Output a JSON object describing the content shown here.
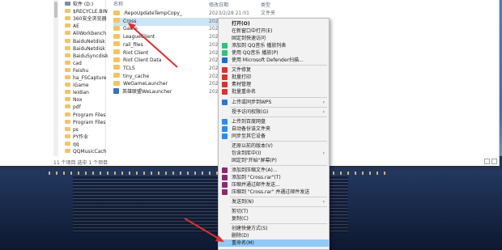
{
  "explorer": {
    "nav_items": [
      {
        "label": "软件 (D:)",
        "kind": "drive"
      },
      {
        "label": "$RECYCLE.BIN",
        "kind": "folder"
      },
      {
        "label": "360安全浏览器",
        "kind": "folder"
      },
      {
        "label": "AE",
        "kind": "folder"
      },
      {
        "label": "AliWorkbench",
        "kind": "folder"
      },
      {
        "label": "BaiduNetdisk",
        "kind": "folder"
      },
      {
        "label": "BaiduNetdisk",
        "kind": "folder"
      },
      {
        "label": "BaiduSyncdisk",
        "kind": "folder"
      },
      {
        "label": "cad",
        "kind": "folder"
      },
      {
        "label": "Feishu",
        "kind": "folder"
      },
      {
        "label": "ha_FSCapture",
        "kind": "folder"
      },
      {
        "label": "iGame",
        "kind": "folder"
      },
      {
        "label": "leidian",
        "kind": "folder"
      },
      {
        "label": "Nox",
        "kind": "folder"
      },
      {
        "label": "pdf",
        "kind": "folder"
      },
      {
        "label": "Program Files",
        "kind": "folder"
      },
      {
        "label": "Program Files",
        "kind": "folder"
      },
      {
        "label": "ps",
        "kind": "folder"
      },
      {
        "label": "PY作业",
        "kind": "folder"
      },
      {
        "label": "qq",
        "kind": "folder"
      },
      {
        "label": "QQMusicCach",
        "kind": "folder"
      }
    ],
    "header_name": "名称",
    "header_date": "修改日期",
    "header_type": "类型",
    "files": [
      {
        "name": ".RepoUpdateTempCopy_",
        "icon": "folder",
        "date": "2023/2/28 21:01",
        "type": "文件夹"
      },
      {
        "name": "Cross",
        "icon": "folder",
        "date": "2023/",
        "type": "",
        "selected": true
      },
      {
        "name": "Game",
        "icon": "folder",
        "date": "2023/",
        "type": ""
      },
      {
        "name": "LeagueClient",
        "icon": "folder",
        "date": "2023/",
        "type": ""
      },
      {
        "name": "rail_files",
        "icon": "folder",
        "date": "2023/",
        "type": ""
      },
      {
        "name": "Riot Client",
        "icon": "folder",
        "date": "2023/",
        "type": ""
      },
      {
        "name": "Riot Client Data",
        "icon": "folder",
        "date": "2023/",
        "type": ""
      },
      {
        "name": "TCLS",
        "icon": "folder",
        "date": "2023/",
        "type": ""
      },
      {
        "name": "tiny_cache",
        "icon": "folder",
        "date": "2023/",
        "type": ""
      },
      {
        "name": "WeGameLauncher",
        "icon": "folder",
        "date": "2023/",
        "type": ""
      },
      {
        "name": "英雄联盟WeLauncher",
        "icon": "app",
        "date": "2023/",
        "type": ""
      }
    ],
    "status": "11 个项目    选中 1 个项目"
  },
  "context_menu": {
    "items": [
      {
        "label": "打开(O)",
        "icon": "none",
        "bold": true
      },
      {
        "label": "在新窗口中打开(E)",
        "icon": "none"
      },
      {
        "label": "固定到快速访问",
        "icon": "none"
      },
      {
        "label": "添加到 QQ音乐 播放列表",
        "icon": "qqmusic-icon",
        "color": "#31c27c"
      },
      {
        "label": "使用 QQ音乐 播放(P)",
        "icon": "qqmusic-icon",
        "color": "#31c27c"
      },
      {
        "label": "使用 Microsoft Defender扫描...",
        "icon": "defender-icon",
        "color": "#1c6fd1"
      },
      {
        "sep": true
      },
      {
        "label": "文件修复",
        "icon": "wps-icon",
        "color": "#d9332e"
      },
      {
        "label": "批量打印",
        "icon": "wps-icon",
        "color": "#d9332e"
      },
      {
        "label": "素材管理",
        "icon": "wps-icon",
        "color": "#d9332e"
      },
      {
        "label": "批量重命名",
        "icon": "wps-icon",
        "color": "#d9332e"
      },
      {
        "sep": true
      },
      {
        "label": "上传或同步到WPS",
        "icon": "wps-cloud-icon",
        "color": "#2a78d2",
        "submenu": true
      },
      {
        "sep": true
      },
      {
        "label": "授予访问权限(G)",
        "icon": "none",
        "submenu": true
      },
      {
        "sep": true
      },
      {
        "label": "上传到百度网盘",
        "icon": "baidu-icon",
        "color": "#2a8cf0"
      },
      {
        "label": "自动备份该文件夹",
        "icon": "baidu-icon",
        "color": "#2a8cf0"
      },
      {
        "label": "同步至其它设备",
        "icon": "baidu-icon",
        "color": "#2a8cf0"
      },
      {
        "sep": true
      },
      {
        "label": "还原以前的版本(V)",
        "icon": "none"
      },
      {
        "label": "包含到库中(I)",
        "icon": "none",
        "submenu": true
      },
      {
        "label": "固定到\"开始\"屏幕(P)",
        "icon": "none"
      },
      {
        "sep": true
      },
      {
        "label": "添加到压缩文件(A)...",
        "icon": "winrar-icon",
        "color": "#8b2a6e"
      },
      {
        "label": "添加到 \"Cross.rar\"(T)",
        "icon": "winrar-icon",
        "color": "#8b2a6e"
      },
      {
        "label": "压缩并通过邮件发送...",
        "icon": "winrar-icon",
        "color": "#8b2a6e"
      },
      {
        "label": "压缩到 \"Cross.rar\" 并通过邮件发送",
        "icon": "winrar-icon",
        "color": "#8b2a6e"
      },
      {
        "sep": true
      },
      {
        "label": "发送到(N)",
        "icon": "none",
        "submenu": true
      },
      {
        "sep": true
      },
      {
        "label": "剪切(T)",
        "icon": "none"
      },
      {
        "label": "复制(C)",
        "icon": "none"
      },
      {
        "sep": true
      },
      {
        "label": "创建快捷方式(S)",
        "icon": "none"
      },
      {
        "label": "删除(D)",
        "icon": "none"
      },
      {
        "label": "重命名(M)",
        "icon": "none",
        "highlight": true
      }
    ]
  }
}
